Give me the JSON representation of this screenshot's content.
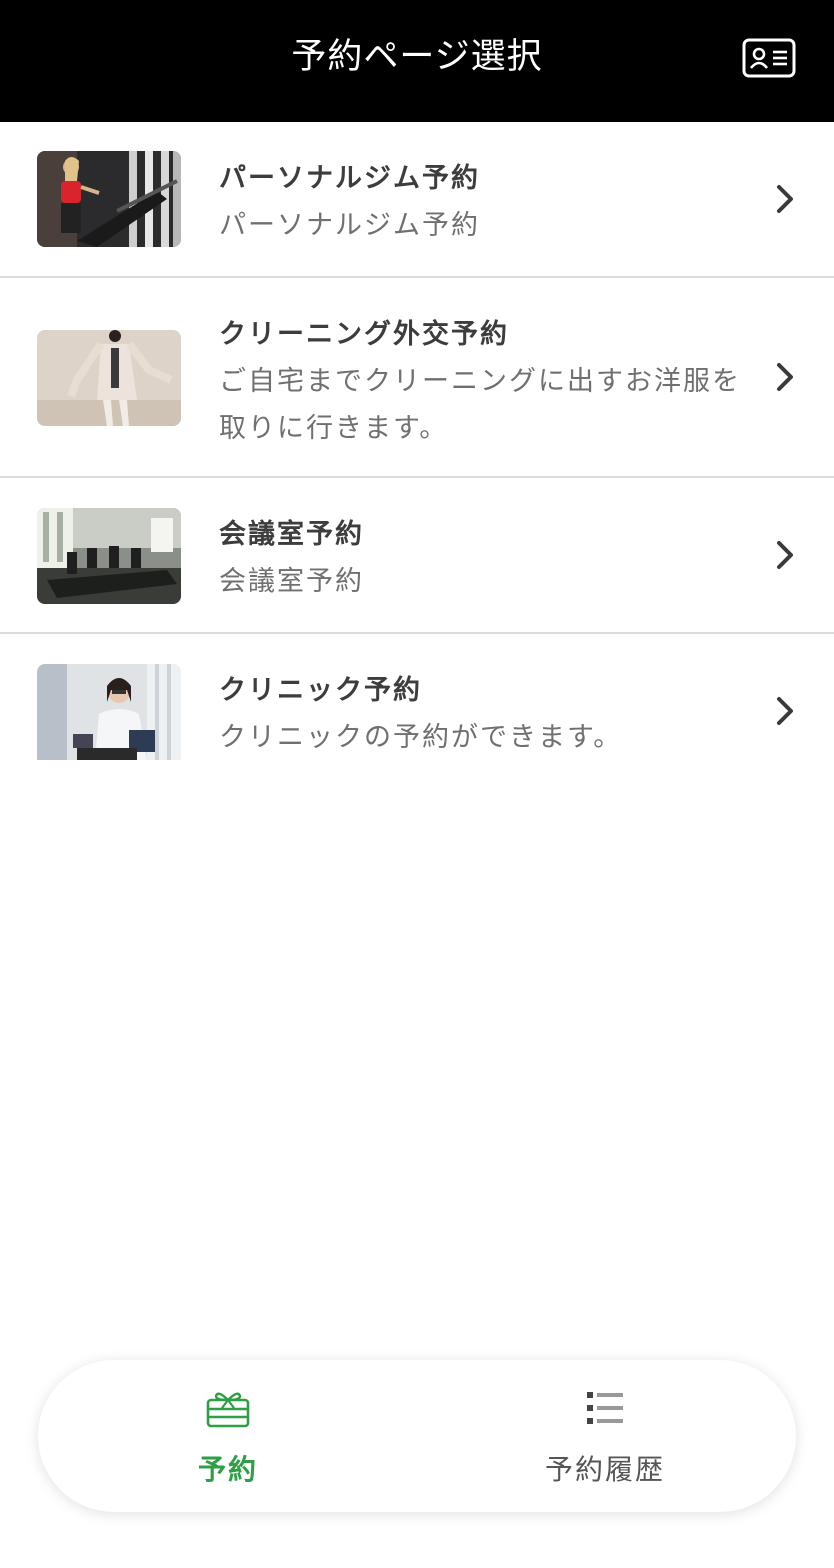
{
  "header": {
    "title": "予約ページ選択",
    "profile_icon": "id-card-icon"
  },
  "menu": {
    "items": [
      {
        "title": "パーソナルジム予約",
        "description": "パーソナルジム予約",
        "thumbnail": "gym-treadmill-photo"
      },
      {
        "title": "クリーニング外交予約",
        "description": "ご自宅までクリーニングに出すお洋服を取りに行きます。",
        "thumbnail": "coat-woman-photo"
      },
      {
        "title": "会議室予約",
        "description": "会議室予約",
        "thumbnail": "meeting-room-photo"
      },
      {
        "title": "クリニック予約",
        "description": "クリニックの予約ができます。",
        "thumbnail": "doctor-photo"
      }
    ],
    "chevron_icon": "chevron-right-icon"
  },
  "bottom_nav": {
    "reserve": {
      "label": "予約",
      "icon": "gift-card-icon",
      "active": true
    },
    "history": {
      "label": "予約履歴",
      "icon": "list-icon",
      "active": false
    }
  },
  "colors": {
    "header_bg": "#000000",
    "accent": "#2e9f44",
    "title_text": "#3d3d3d",
    "desc_text": "#707070"
  }
}
